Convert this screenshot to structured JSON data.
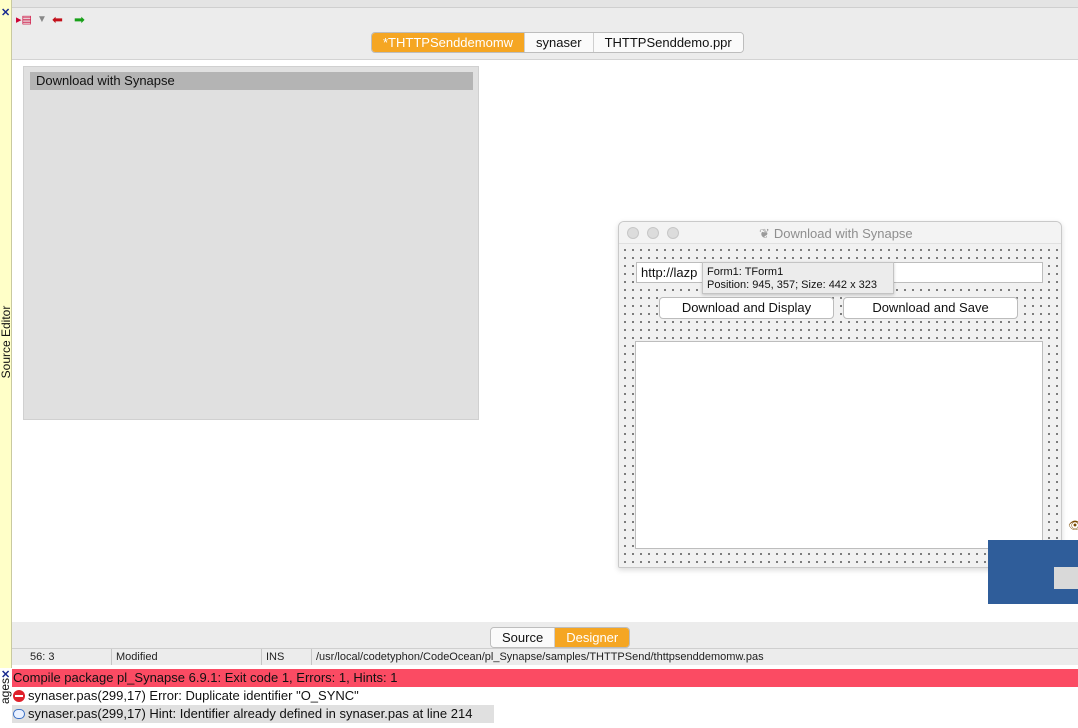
{
  "side_panel": {
    "label": "Source Editor",
    "close": "✕"
  },
  "toolbar": {
    "menu_icon": "▸▤",
    "dropdown": "▼",
    "back": "⬅",
    "forward": "➡"
  },
  "tabs": [
    {
      "label": "*THTTPSenddemomw",
      "active": true
    },
    {
      "label": "synaser",
      "active": false
    },
    {
      "label": "THTTPSenddemo.ppr",
      "active": false
    }
  ],
  "non_visual_panel": {
    "title": "Download with Synapse"
  },
  "form": {
    "title": "Download with Synapse",
    "url_value": "http://lazp",
    "buttons": {
      "display": "Download and Display",
      "save": "Download and Save"
    }
  },
  "hint": {
    "line1": "Form1: TForm1",
    "line2": "Position: 945, 357; Size: 442 x 323"
  },
  "designer_tabs": [
    {
      "label": "Source",
      "active": false
    },
    {
      "label": "Designer",
      "active": true
    }
  ],
  "statusbar": {
    "position": "56:  3",
    "modified": "Modified",
    "mode": "INS",
    "path": "/usr/local/codetyphon/CodeOcean/pl_Synapse/samples/THTTPSend/thttpsenddemomw.pas"
  },
  "messages": {
    "side_label": "ages",
    "close": "✕",
    "items": [
      {
        "text": "Compile package pl_Synapse 6.9.1: Exit code 1, Errors: 1, Hints: 1",
        "kind": "header"
      },
      {
        "text": "synaser.pas(299,17) Error: Duplicate identifier \"O_SYNC\"",
        "kind": "error"
      },
      {
        "text": "synaser.pas(299,17) Hint: Identifier already defined in synaser.pas at line 214",
        "kind": "hint"
      }
    ]
  },
  "colors": {
    "accent": "#f5a623",
    "error_bar": "#fb4b63",
    "side_strip": "#ffffc8"
  }
}
